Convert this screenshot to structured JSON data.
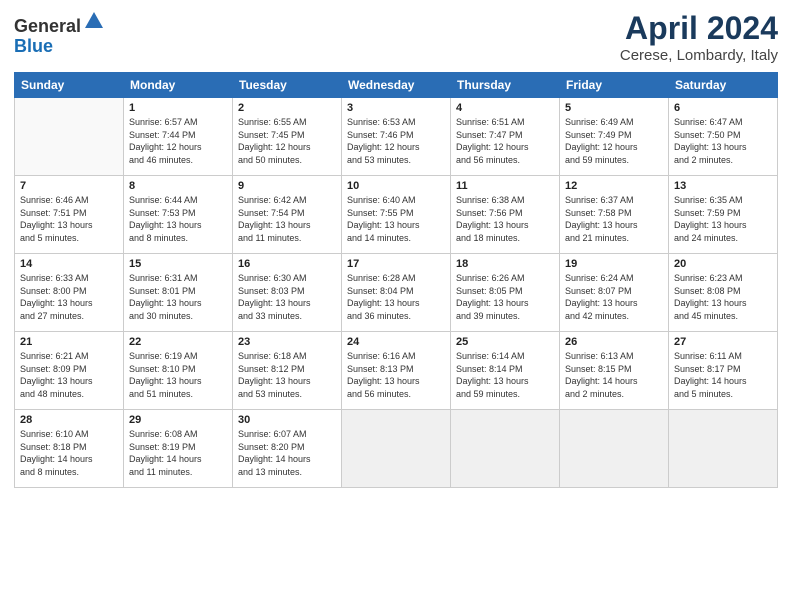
{
  "header": {
    "logo_line1": "General",
    "logo_line2": "Blue",
    "month_title": "April 2024",
    "location": "Cerese, Lombardy, Italy"
  },
  "days_of_week": [
    "Sunday",
    "Monday",
    "Tuesday",
    "Wednesday",
    "Thursday",
    "Friday",
    "Saturday"
  ],
  "weeks": [
    [
      {
        "day": "",
        "info": ""
      },
      {
        "day": "1",
        "info": "Sunrise: 6:57 AM\nSunset: 7:44 PM\nDaylight: 12 hours\nand 46 minutes."
      },
      {
        "day": "2",
        "info": "Sunrise: 6:55 AM\nSunset: 7:45 PM\nDaylight: 12 hours\nand 50 minutes."
      },
      {
        "day": "3",
        "info": "Sunrise: 6:53 AM\nSunset: 7:46 PM\nDaylight: 12 hours\nand 53 minutes."
      },
      {
        "day": "4",
        "info": "Sunrise: 6:51 AM\nSunset: 7:47 PM\nDaylight: 12 hours\nand 56 minutes."
      },
      {
        "day": "5",
        "info": "Sunrise: 6:49 AM\nSunset: 7:49 PM\nDaylight: 12 hours\nand 59 minutes."
      },
      {
        "day": "6",
        "info": "Sunrise: 6:47 AM\nSunset: 7:50 PM\nDaylight: 13 hours\nand 2 minutes."
      }
    ],
    [
      {
        "day": "7",
        "info": "Sunrise: 6:46 AM\nSunset: 7:51 PM\nDaylight: 13 hours\nand 5 minutes."
      },
      {
        "day": "8",
        "info": "Sunrise: 6:44 AM\nSunset: 7:53 PM\nDaylight: 13 hours\nand 8 minutes."
      },
      {
        "day": "9",
        "info": "Sunrise: 6:42 AM\nSunset: 7:54 PM\nDaylight: 13 hours\nand 11 minutes."
      },
      {
        "day": "10",
        "info": "Sunrise: 6:40 AM\nSunset: 7:55 PM\nDaylight: 13 hours\nand 14 minutes."
      },
      {
        "day": "11",
        "info": "Sunrise: 6:38 AM\nSunset: 7:56 PM\nDaylight: 13 hours\nand 18 minutes."
      },
      {
        "day": "12",
        "info": "Sunrise: 6:37 AM\nSunset: 7:58 PM\nDaylight: 13 hours\nand 21 minutes."
      },
      {
        "day": "13",
        "info": "Sunrise: 6:35 AM\nSunset: 7:59 PM\nDaylight: 13 hours\nand 24 minutes."
      }
    ],
    [
      {
        "day": "14",
        "info": "Sunrise: 6:33 AM\nSunset: 8:00 PM\nDaylight: 13 hours\nand 27 minutes."
      },
      {
        "day": "15",
        "info": "Sunrise: 6:31 AM\nSunset: 8:01 PM\nDaylight: 13 hours\nand 30 minutes."
      },
      {
        "day": "16",
        "info": "Sunrise: 6:30 AM\nSunset: 8:03 PM\nDaylight: 13 hours\nand 33 minutes."
      },
      {
        "day": "17",
        "info": "Sunrise: 6:28 AM\nSunset: 8:04 PM\nDaylight: 13 hours\nand 36 minutes."
      },
      {
        "day": "18",
        "info": "Sunrise: 6:26 AM\nSunset: 8:05 PM\nDaylight: 13 hours\nand 39 minutes."
      },
      {
        "day": "19",
        "info": "Sunrise: 6:24 AM\nSunset: 8:07 PM\nDaylight: 13 hours\nand 42 minutes."
      },
      {
        "day": "20",
        "info": "Sunrise: 6:23 AM\nSunset: 8:08 PM\nDaylight: 13 hours\nand 45 minutes."
      }
    ],
    [
      {
        "day": "21",
        "info": "Sunrise: 6:21 AM\nSunset: 8:09 PM\nDaylight: 13 hours\nand 48 minutes."
      },
      {
        "day": "22",
        "info": "Sunrise: 6:19 AM\nSunset: 8:10 PM\nDaylight: 13 hours\nand 51 minutes."
      },
      {
        "day": "23",
        "info": "Sunrise: 6:18 AM\nSunset: 8:12 PM\nDaylight: 13 hours\nand 53 minutes."
      },
      {
        "day": "24",
        "info": "Sunrise: 6:16 AM\nSunset: 8:13 PM\nDaylight: 13 hours\nand 56 minutes."
      },
      {
        "day": "25",
        "info": "Sunrise: 6:14 AM\nSunset: 8:14 PM\nDaylight: 13 hours\nand 59 minutes."
      },
      {
        "day": "26",
        "info": "Sunrise: 6:13 AM\nSunset: 8:15 PM\nDaylight: 14 hours\nand 2 minutes."
      },
      {
        "day": "27",
        "info": "Sunrise: 6:11 AM\nSunset: 8:17 PM\nDaylight: 14 hours\nand 5 minutes."
      }
    ],
    [
      {
        "day": "28",
        "info": "Sunrise: 6:10 AM\nSunset: 8:18 PM\nDaylight: 14 hours\nand 8 minutes."
      },
      {
        "day": "29",
        "info": "Sunrise: 6:08 AM\nSunset: 8:19 PM\nDaylight: 14 hours\nand 11 minutes."
      },
      {
        "day": "30",
        "info": "Sunrise: 6:07 AM\nSunset: 8:20 PM\nDaylight: 14 hours\nand 13 minutes."
      },
      {
        "day": "",
        "info": ""
      },
      {
        "day": "",
        "info": ""
      },
      {
        "day": "",
        "info": ""
      },
      {
        "day": "",
        "info": ""
      }
    ]
  ]
}
